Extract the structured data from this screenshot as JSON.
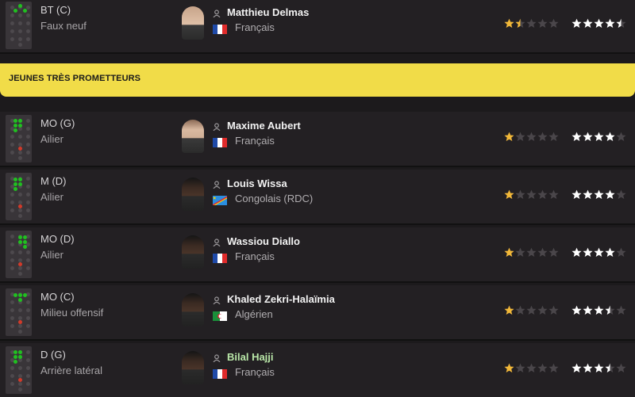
{
  "section_title": "JEUNES TRÈS PROMETTEURS",
  "colors": {
    "accent_yellow": "#f1dc48",
    "star_gold": "#f2b838",
    "star_white": "#ffffff",
    "star_empty": "#4a464a"
  },
  "players": [
    {
      "position": "BT (C)",
      "role": "Faux neuf",
      "name": "Matthieu Delmas",
      "nationality": "Français",
      "flag": "france",
      "current_ability": 1.5,
      "potential_ability": 4.5
    },
    {
      "position": "MO (G)",
      "role": "Ailier",
      "name": "Maxime Aubert",
      "nationality": "Français",
      "flag": "france",
      "current_ability": 1,
      "potential_ability": 4
    },
    {
      "position": "M (D)",
      "role": "Ailier",
      "name": "Louis Wissa",
      "nationality": "Congolais (RDC)",
      "flag": "dr-congo",
      "current_ability": 1,
      "potential_ability": 4
    },
    {
      "position": "MO (D)",
      "role": "Ailier",
      "name": "Wassiou Diallo",
      "nationality": "Français",
      "flag": "france",
      "current_ability": 1,
      "potential_ability": 4
    },
    {
      "position": "MO (C)",
      "role": "Milieu offensif",
      "name": "Khaled Zekri-Halaïmia",
      "nationality": "Algérien",
      "flag": "algeria",
      "current_ability": 1,
      "potential_ability": 3.5
    },
    {
      "position": "D (G)",
      "role": "Arrière latéral",
      "name": "Bilal Hajji",
      "nationality": "Français",
      "flag": "france",
      "current_ability": 1,
      "potential_ability": 3.5
    }
  ]
}
